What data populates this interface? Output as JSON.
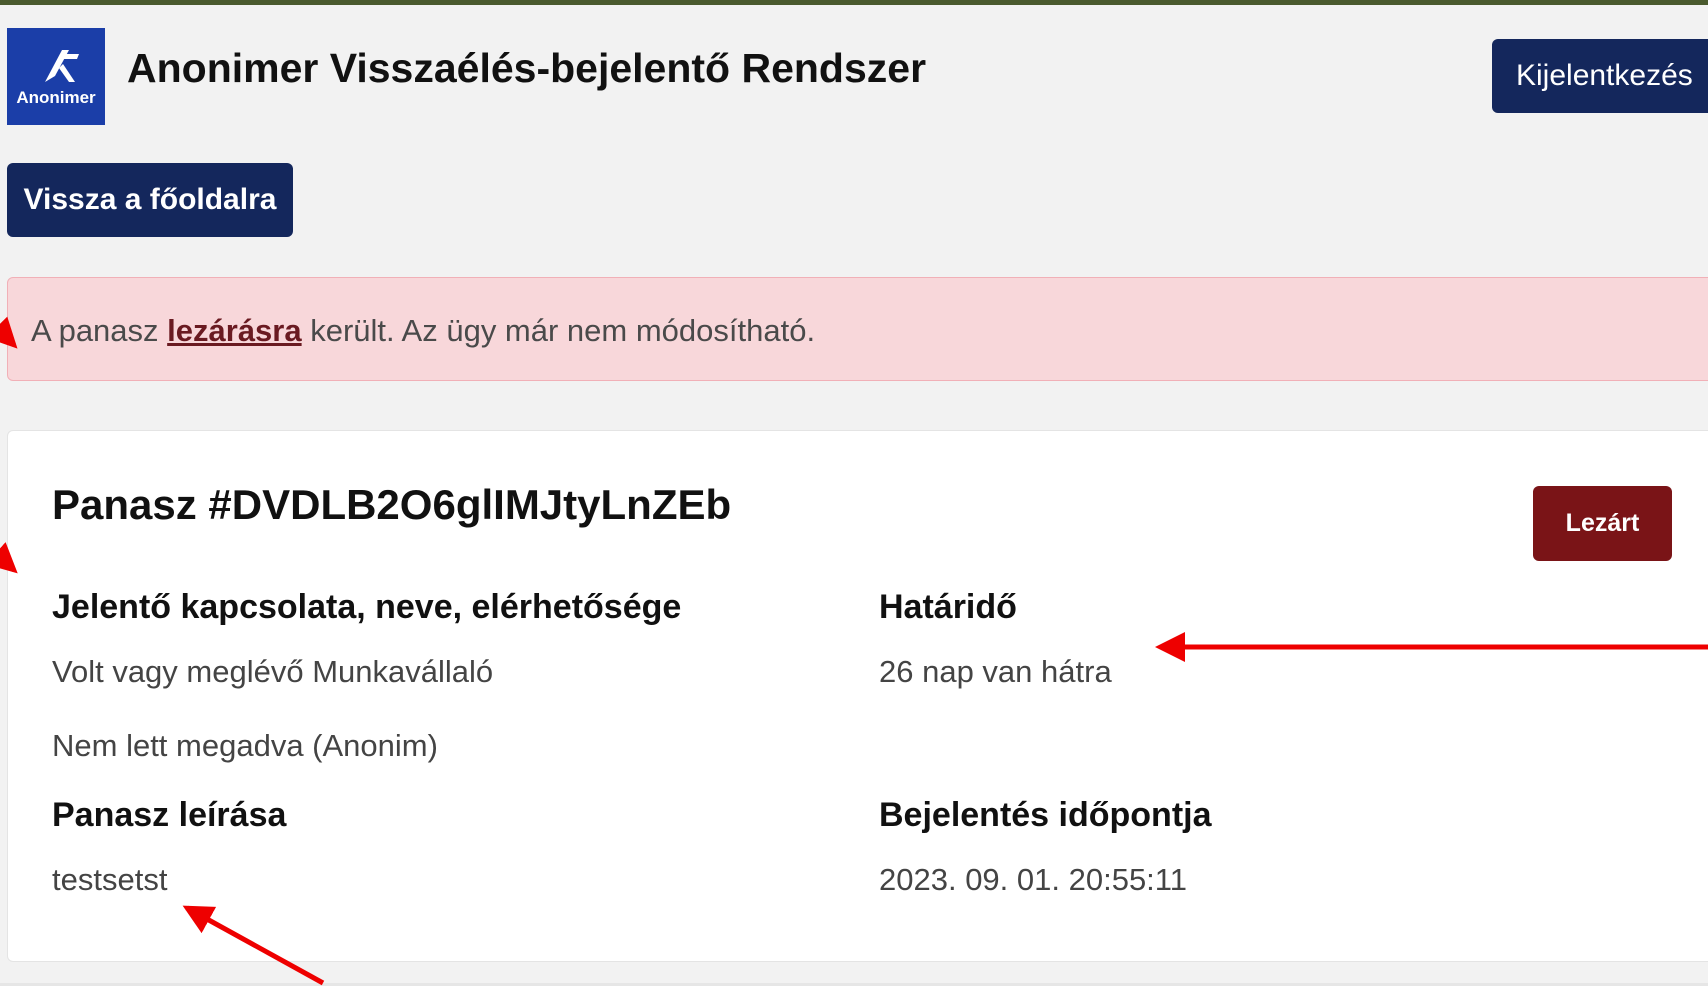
{
  "header": {
    "logo_text": "Anonimer",
    "title": "Anonimer Visszaélés-bejelentő Rendszer",
    "logout_label": "Kijelentkezés"
  },
  "nav": {
    "back_label": "Vissza a főoldalra"
  },
  "alert": {
    "prefix": "A panasz ",
    "link": "lezárásra",
    "suffix": " került. Az ügy már nem módosítható."
  },
  "complaint": {
    "title": "Panasz #DVDLB2O6glIMJtyLnZEb",
    "status": "Lezárt",
    "reporter_label": "Jelentő kapcsolata, neve, elérhetősége",
    "reporter_relation": "Volt vagy meglévő Munkavállaló",
    "reporter_name": "Nem lett megadva (Anonim)",
    "deadline_label": "Határidő",
    "deadline_value": "26 nap van hátra",
    "description_label": "Panasz leírása",
    "description_value": "testsetst",
    "reported_at_label": "Bejelentés időpontja",
    "reported_at_value": "2023. 09. 01. 20:55:11"
  },
  "colors": {
    "brand_blue": "#1b3ea8",
    "navy_button": "#14275c",
    "alert_background": "#f8d7da",
    "closed_badge": "#7a1417",
    "annotation_arrow": "#ee0000"
  }
}
